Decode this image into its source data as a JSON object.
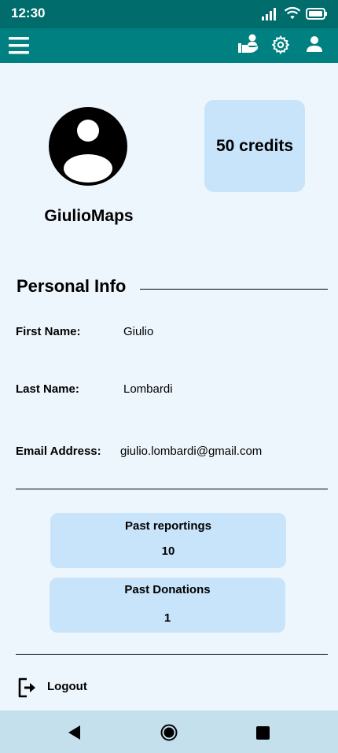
{
  "status_bar": {
    "time": "12:30"
  },
  "toolbar": {
    "menu_icon": "hamburger-menu-icon",
    "donate_icon": "hand-heart-person-icon",
    "settings_icon": "gear-icon",
    "profile_icon": "person-icon",
    "bar_color": "#008080"
  },
  "profile": {
    "username": "GiulioMaps",
    "credits": "50 credits",
    "avatar_icon": "user-circle-icon"
  },
  "personal_info": {
    "title": "Personal Info",
    "fields": [
      {
        "label": "First Name:",
        "value": "Giulio"
      },
      {
        "label": "Last Name:",
        "value": "Lombardi"
      },
      {
        "label": "Email Address:",
        "value": "giulio.lombardi@gmail.com"
      }
    ]
  },
  "stats": [
    {
      "label": "Past reportings",
      "value": "10"
    },
    {
      "label": "Past Donations",
      "value": "1"
    }
  ],
  "logout": {
    "label": "Logout",
    "icon": "logout-icon"
  },
  "accent_colors": {
    "card": "#c8e4fb",
    "background": "#eef6fd",
    "nav_bar": "#c5e0ed"
  }
}
